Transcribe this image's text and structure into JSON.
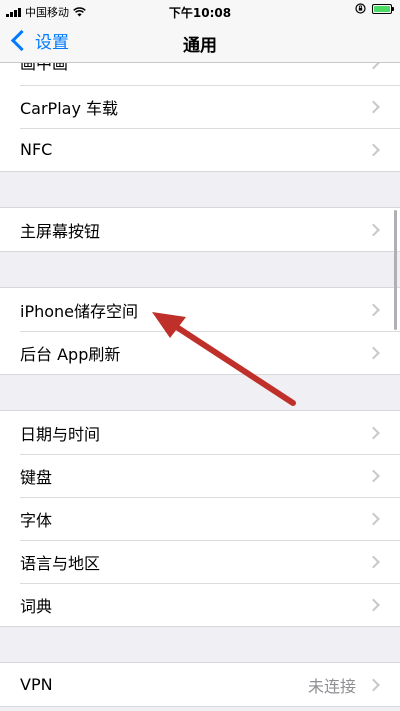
{
  "status_bar": {
    "carrier": "中国移动",
    "time": "下午10:08",
    "battery_level": 1.0,
    "battery_color": "#4cd964"
  },
  "nav": {
    "back_label": "设置",
    "title": "通用"
  },
  "groups": [
    {
      "items": [
        {
          "label": "画中画",
          "partial": true
        },
        {
          "label": "CarPlay 车载"
        },
        {
          "label": "NFC"
        }
      ]
    },
    {
      "items": [
        {
          "label": "主屏幕按钮"
        }
      ]
    },
    {
      "items": [
        {
          "label": "iPhone储存空间"
        },
        {
          "label": "后台 App刷新"
        }
      ]
    },
    {
      "items": [
        {
          "label": "日期与时间"
        },
        {
          "label": "键盘"
        },
        {
          "label": "字体"
        },
        {
          "label": "语言与地区"
        },
        {
          "label": "词典"
        }
      ]
    },
    {
      "items": [
        {
          "label": "VPN",
          "detail": "未连接"
        }
      ]
    }
  ],
  "colors": {
    "accent": "#007aff",
    "annotation_arrow": "#c0302b"
  }
}
